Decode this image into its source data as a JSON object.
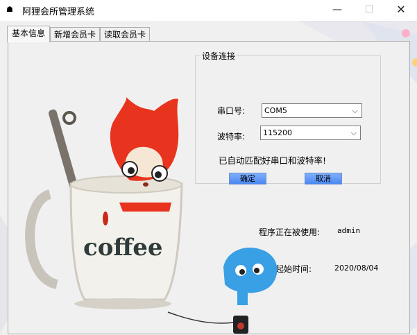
{
  "window": {
    "title": "阿狸会所管理系统",
    "minimize": "—",
    "maximize": "☐",
    "close": "✕"
  },
  "tabs": [
    {
      "label": "基本信息"
    },
    {
      "label": "新增会员卡"
    },
    {
      "label": "读取会员卡"
    }
  ],
  "device": {
    "group_title": "设备连接",
    "port_label": "串口号:",
    "port_value": "COM5",
    "baud_label": "波特率:",
    "baud_value": "115200",
    "status_message": "已自动匹配好串口和波特率!",
    "ok_button": "确定",
    "cancel_button": "取消"
  },
  "info": {
    "user_label": "程序正在被使用:",
    "user_value": "admin",
    "start_label": "使用起始时间:",
    "start_value": "2020/08/04"
  },
  "icons": {
    "app": "ali-app-icon",
    "dropdown": "chevron-down-icon"
  },
  "colors": {
    "button_blue": "#5a90f5",
    "fox_red": "#e8341f"
  }
}
